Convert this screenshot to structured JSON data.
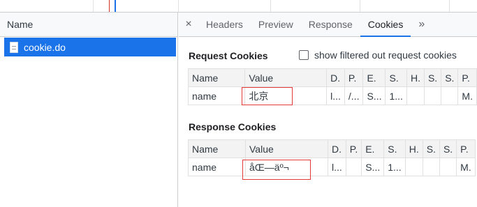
{
  "network": {
    "name_column_label": "Name",
    "requests": [
      {
        "name": "cookie.do",
        "selected": true
      }
    ]
  },
  "tabs": {
    "close_label": "×",
    "items": [
      {
        "label": "Headers",
        "active": false
      },
      {
        "label": "Preview",
        "active": false
      },
      {
        "label": "Response",
        "active": false
      },
      {
        "label": "Cookies",
        "active": true
      }
    ],
    "more_label": "»"
  },
  "request_cookies": {
    "title": "Request Cookies",
    "filter_checkbox_label": "show filtered out request cookies",
    "filter_checked": false,
    "columns": [
      "Name",
      "Value",
      "D.",
      "P.",
      "E.",
      "S.",
      "H.",
      "S.",
      "S.",
      "P."
    ],
    "rows": [
      [
        "name",
        "北京",
        "l...",
        "/...",
        "S...",
        "1...",
        "",
        "",
        "",
        "M."
      ]
    ]
  },
  "response_cookies": {
    "title": "Response Cookies",
    "columns": [
      "Name",
      "Value",
      "D.",
      "P.",
      "E.",
      "S.",
      "H.",
      "S.",
      "S.",
      "P."
    ],
    "rows": [
      [
        "name",
        "åŒ—äº¬",
        "l...",
        "",
        "S...",
        "1...",
        "",
        "",
        "",
        "M."
      ]
    ]
  },
  "colors": {
    "selection": "#1a73e8",
    "highlight_border": "#e53935",
    "active_tab_underline": "#1a73e8"
  }
}
